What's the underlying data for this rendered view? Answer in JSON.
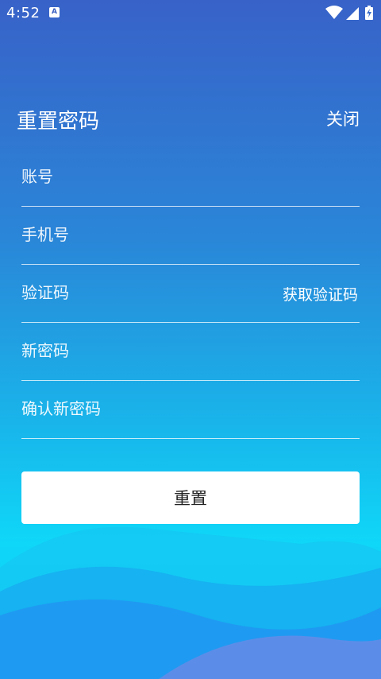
{
  "status_bar": {
    "time": "4:52",
    "notification_icon": "a-letter-icon",
    "icons": [
      "wifi-icon",
      "cell-signal-icon",
      "battery-charging-icon"
    ]
  },
  "header": {
    "title": "重置密码",
    "close_label": "关闭"
  },
  "form": {
    "account_placeholder": "账号",
    "phone_placeholder": "手机号",
    "code_placeholder": "验证码",
    "get_code_label": "获取验证码",
    "new_password_placeholder": "新密码",
    "confirm_password_placeholder": "确认新密码",
    "submit_label": "重置"
  },
  "colors": {
    "gradient_top": "#3862c8",
    "gradient_bottom": "#0fd7f8",
    "button_bg": "#ffffff",
    "button_text": "#222222"
  }
}
